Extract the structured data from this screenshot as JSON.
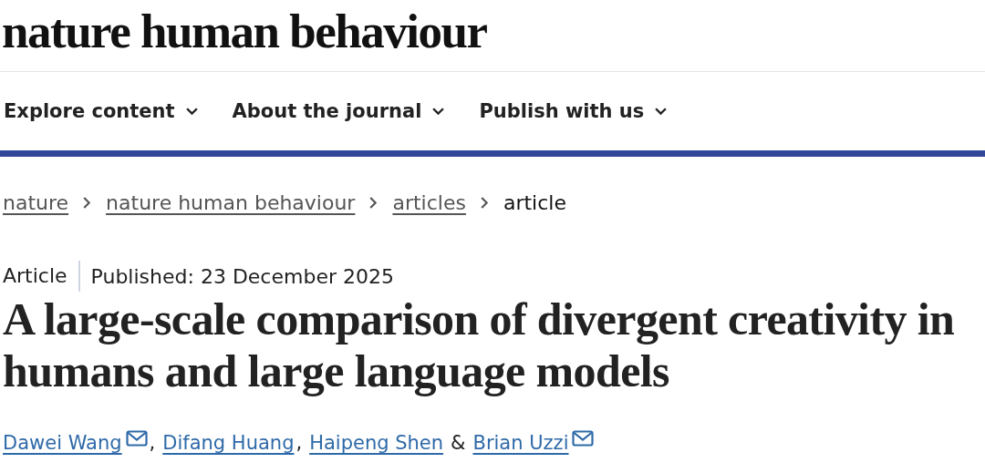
{
  "logo": "nature human behaviour",
  "nav": [
    {
      "label": "Explore content"
    },
    {
      "label": "About the journal"
    },
    {
      "label": "Publish with us"
    }
  ],
  "breadcrumbs": [
    {
      "label": "nature",
      "kind": "link"
    },
    {
      "label": "nature human behaviour",
      "kind": "link"
    },
    {
      "label": "articles",
      "kind": "link"
    },
    {
      "label": "article",
      "kind": "current"
    }
  ],
  "article": {
    "type": "Article",
    "published": "Published: 23 December 2025",
    "title": "A large-scale comparison of divergent creativity in humans and large language models",
    "authors": [
      {
        "name": "Dawei Wang",
        "email": true,
        "separator": ","
      },
      {
        "name": "Difang Huang",
        "email": false,
        "separator": ","
      },
      {
        "name": "Haipeng Shen",
        "email": false,
        "separator": "&"
      },
      {
        "name": "Brian Uzzi",
        "email": true
      }
    ]
  }
}
